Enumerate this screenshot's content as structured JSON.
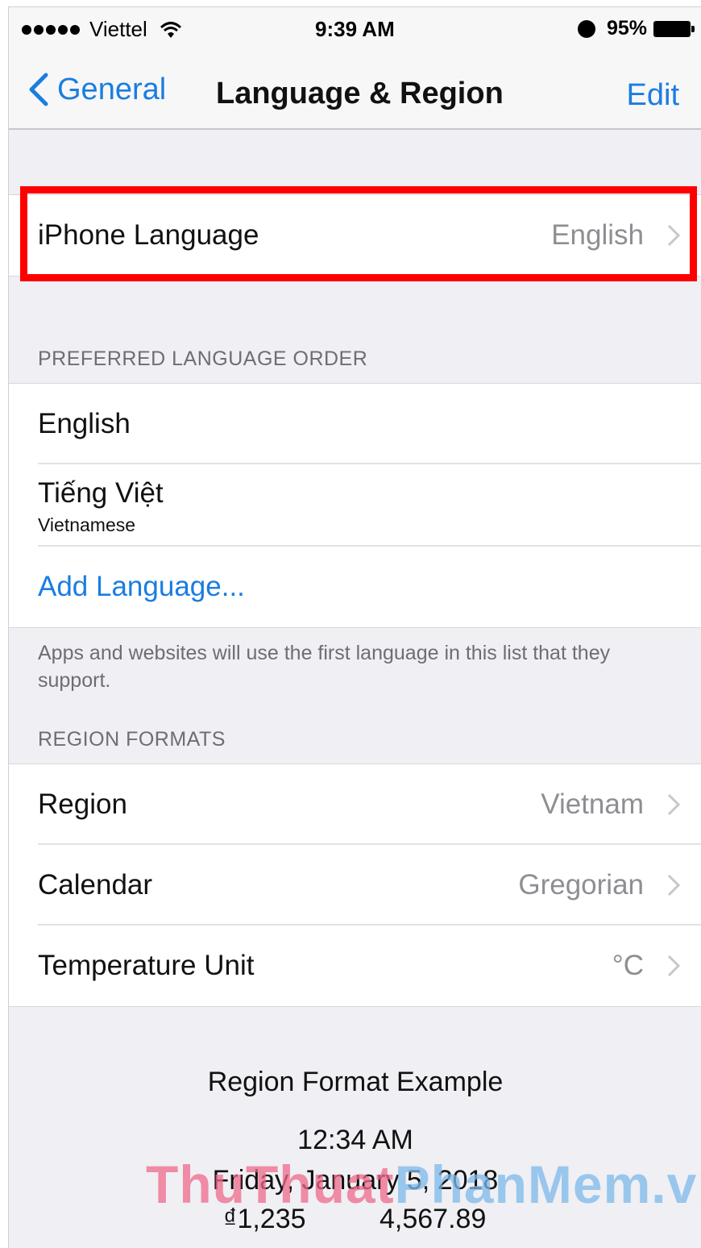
{
  "status_bar": {
    "carrier": "Viettel",
    "time": "9:39 AM",
    "battery": "95%"
  },
  "nav": {
    "back_label": "General",
    "title": "Language & Region",
    "edit_label": "Edit"
  },
  "iphone_language": {
    "label": "iPhone Language",
    "value": "English"
  },
  "preferred": {
    "header": "PREFERRED LANGUAGE ORDER",
    "languages": [
      {
        "name": "English",
        "subtitle": ""
      },
      {
        "name": "Tiếng Việt",
        "subtitle": "Vietnamese"
      }
    ],
    "add_label": "Add Language...",
    "footer": "Apps and websites will use the first language in this list that they support."
  },
  "region_formats": {
    "header": "REGION FORMATS",
    "rows": [
      {
        "label": "Region",
        "value": "Vietnam"
      },
      {
        "label": "Calendar",
        "value": "Gregorian"
      },
      {
        "label": "Temperature Unit",
        "value": "°C"
      }
    ]
  },
  "example": {
    "title": "Region Format Example",
    "time": "12:34 AM",
    "date": "Friday, January 5, 2018",
    "currency": "₫1,235",
    "number": "4,567.89"
  },
  "watermark": {
    "part1": "ThuThuat",
    "part2": "PhanMem.vn"
  },
  "colors": {
    "accent": "#1a7de0",
    "highlight": "#ff0000",
    "background": "#efeff4"
  },
  "icons": [
    "signal-dots-icon",
    "wifi-icon",
    "alarm-icon",
    "battery-icon",
    "chevron-left-icon",
    "chevron-right-icon"
  ]
}
